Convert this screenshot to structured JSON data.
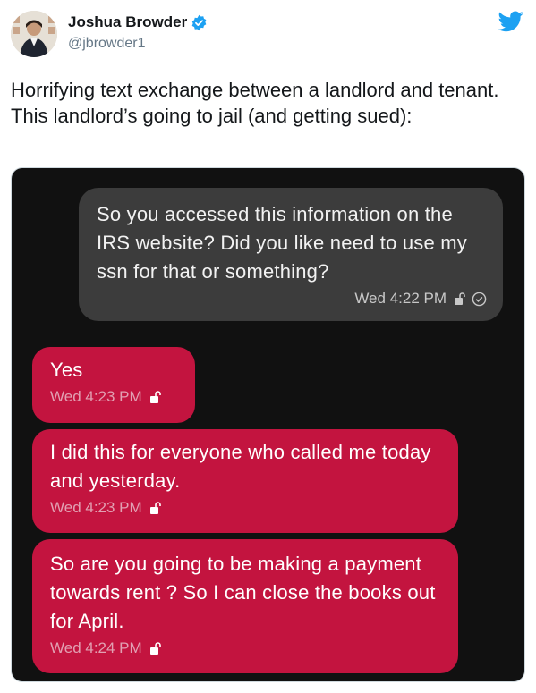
{
  "author": {
    "name": "Joshua Browder",
    "handle": "@jbrowder1"
  },
  "tweet": {
    "text": "Horrifying text exchange between a landlord and tenant. This landlord’s going to jail (and getting sued):"
  },
  "messages": [
    {
      "direction": "outgoing",
      "text": "So you accessed this information on the IRS website? Did you like need to use my ssn for that or something?",
      "time": "Wed 4:22 PM",
      "icons": [
        "unlock-icon",
        "check-circle-icon"
      ]
    },
    {
      "direction": "incoming",
      "text": "Yes",
      "time": "Wed 4:23 PM",
      "icons": [
        "unlock-icon"
      ]
    },
    {
      "direction": "incoming",
      "text": "I did this for everyone who called me today and yesterday.",
      "time": "Wed 4:23 PM",
      "icons": [
        "unlock-icon"
      ]
    },
    {
      "direction": "incoming",
      "text": "So are you going to be making a payment towards rent ? So I can close the books out for April.",
      "time": "Wed 4:24 PM",
      "icons": [
        "unlock-icon"
      ]
    }
  ],
  "colors": {
    "twitter_blue": "#1da1f2",
    "incoming_bubble": "#c3143f",
    "outgoing_bubble": "#3c3c3c",
    "media_background": "#111111"
  }
}
